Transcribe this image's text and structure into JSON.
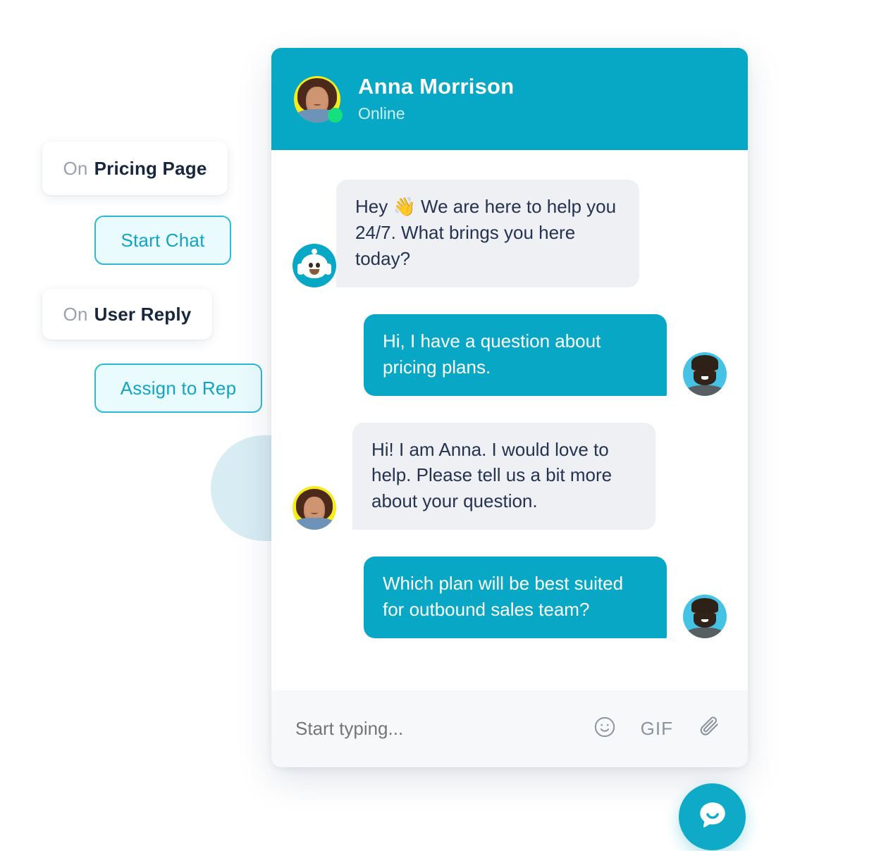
{
  "flow": {
    "chips": [
      {
        "id": "chip-pricing",
        "type": "plain",
        "prefix": "On",
        "label": "Pricing Page"
      },
      {
        "id": "chip-start",
        "type": "teal",
        "prefix": "",
        "label": "Start Chat"
      },
      {
        "id": "chip-reply",
        "type": "plain",
        "prefix": "On",
        "label": "User Reply"
      },
      {
        "id": "chip-assign",
        "type": "teal",
        "prefix": "",
        "label": "Assign to Rep"
      }
    ]
  },
  "header": {
    "name": "Anna Morrison",
    "status": "Online",
    "avatar_icon": "agent-photo-avatar",
    "status_icon": "online-dot-icon",
    "background_color": "#07A7C6"
  },
  "messages": [
    {
      "sender": "bot",
      "avatar_icon": "bot-avatar-icon",
      "text": "Hey 👋 We are here to help you 24/7. What brings you here today?"
    },
    {
      "sender": "user",
      "avatar_icon": "user-photo-avatar",
      "text": "Hi, I have a question about pricing plans."
    },
    {
      "sender": "agent",
      "avatar_icon": "agent-photo-avatar",
      "text": "Hi! I am Anna. I would love to help. Please tell us a bit more about your question."
    },
    {
      "sender": "user",
      "avatar_icon": "user-photo-avatar",
      "text": "Which plan will be best suited for outbound sales team?"
    }
  ],
  "composer": {
    "placeholder": "Start typing...",
    "value": "",
    "emoji_icon": "smiley-icon",
    "gif_label": "GIF",
    "attach_icon": "paperclip-icon"
  },
  "launcher": {
    "icon": "chat-bubble-icon",
    "color": "#0EAAC8"
  },
  "theme": {
    "accent": "#07A7C6",
    "bubble_in_bg": "#EEF0F4",
    "bubble_out_bg": "#08A7C6",
    "chip_teal_bg": "#EAFBFE",
    "chip_teal_border": "#2EB8D6",
    "chip_text_dark": "#16273F",
    "chip_prefix_gray": "#9AA2AE",
    "pointer_color": "#D7ECF3"
  }
}
